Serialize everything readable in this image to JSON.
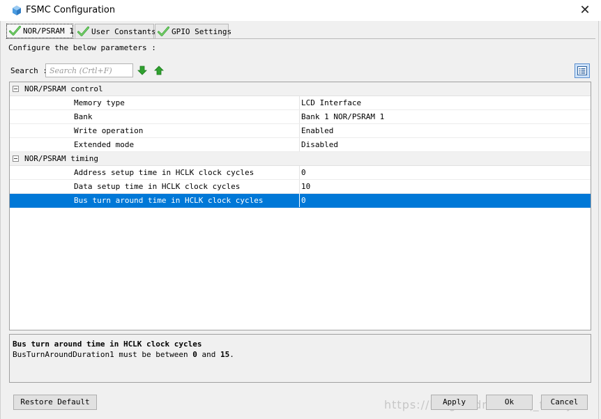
{
  "window": {
    "title": "FSMC Configuration",
    "close_symbol": "✕"
  },
  "tabs": [
    {
      "label": "NOR/PSRAM 1",
      "active": true
    },
    {
      "label": "User Constants",
      "active": false
    },
    {
      "label": "GPIO Settings",
      "active": false
    }
  ],
  "configure_label": "Configure the below parameters :",
  "search": {
    "label": "Search :",
    "placeholder": "Search (Crtl+F)",
    "value": ""
  },
  "tree": {
    "groups": [
      {
        "name": "NOR/PSRAM control",
        "params": [
          {
            "name": "Memory type",
            "value": "LCD Interface"
          },
          {
            "name": "Bank",
            "value": "Bank 1 NOR/PSRAM 1"
          },
          {
            "name": "Write operation",
            "value": "Enabled"
          },
          {
            "name": "Extended mode",
            "value": "Disabled"
          }
        ]
      },
      {
        "name": "NOR/PSRAM timing",
        "params": [
          {
            "name": "Address setup time in HCLK clock cycles",
            "value": "0"
          },
          {
            "name": "Data setup time in HCLK clock cycles",
            "value": "10"
          },
          {
            "name": "Bus turn around time in HCLK clock cycles",
            "value": "0",
            "selected": true
          }
        ]
      }
    ]
  },
  "description": {
    "title": "Bus turn around time in HCLK clock cycles",
    "text_prefix": "BusTurnAroundDuration1 must be between ",
    "min": "0",
    "text_mid": " and ",
    "max": "15",
    "text_suffix": "."
  },
  "buttons": {
    "restore_default": "Restore Default",
    "apply": "Apply",
    "ok": "Ok",
    "cancel": "Cancel"
  },
  "watermark": "https://blog.csdn.net/sq_fancy",
  "colors": {
    "selection": "#0078d7",
    "check_green": "#3aa63a",
    "arrow_green": "#2fa12f"
  },
  "icons": {
    "title": "stm32-cube-icon",
    "tab": "green-check-icon",
    "search_next": "arrow-down-icon",
    "search_prev": "arrow-up-icon",
    "view_toggle": "list-view-icon"
  }
}
